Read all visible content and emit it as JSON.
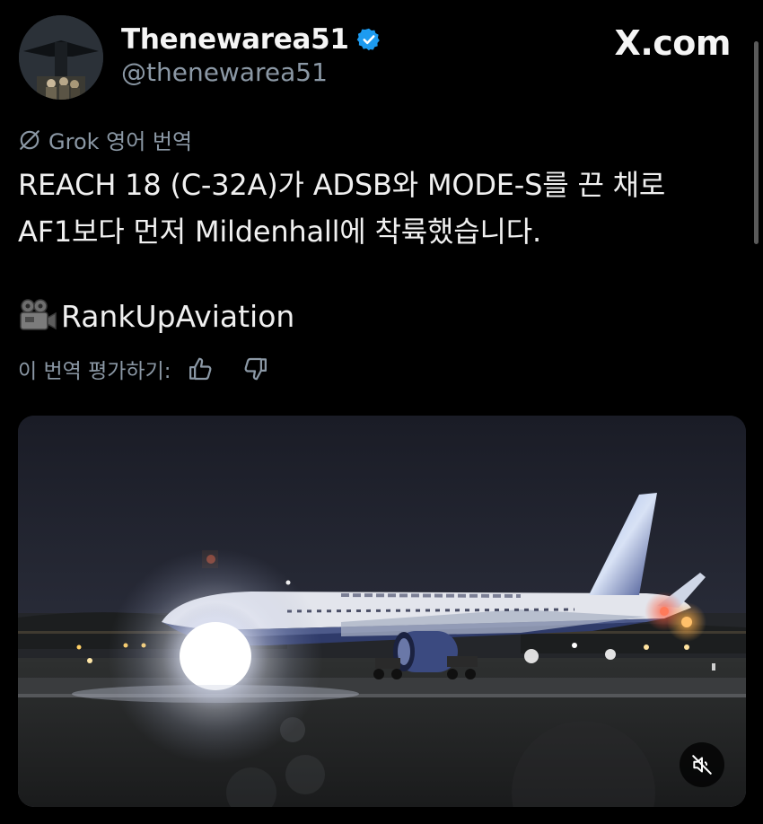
{
  "post": {
    "display_name": "Thenewarea51",
    "handle": "@thenewarea51",
    "verified": true,
    "verified_color": "#1d9bf0"
  },
  "brand": {
    "label": "X.com"
  },
  "translation": {
    "label": "Grok 영어 번역",
    "icon": "grok-icon"
  },
  "tweet": {
    "lines": [
      "REACH 18 (C-32A)가 ADSB와 MODE-S를 끈 채로",
      "AF1보다 먼저 Mildenhall에 착륙했습니다."
    ],
    "credit_emoji": "movie-camera-icon",
    "credit": "RankUpAviation"
  },
  "rating": {
    "label": "이 번역 평가하기:",
    "like_icon": "thumbs-up-icon",
    "dislike_icon": "thumbs-down-icon"
  },
  "media": {
    "type": "video",
    "description_icon": "video-thumbnail",
    "mute_icon": "muted-speaker-icon"
  }
}
